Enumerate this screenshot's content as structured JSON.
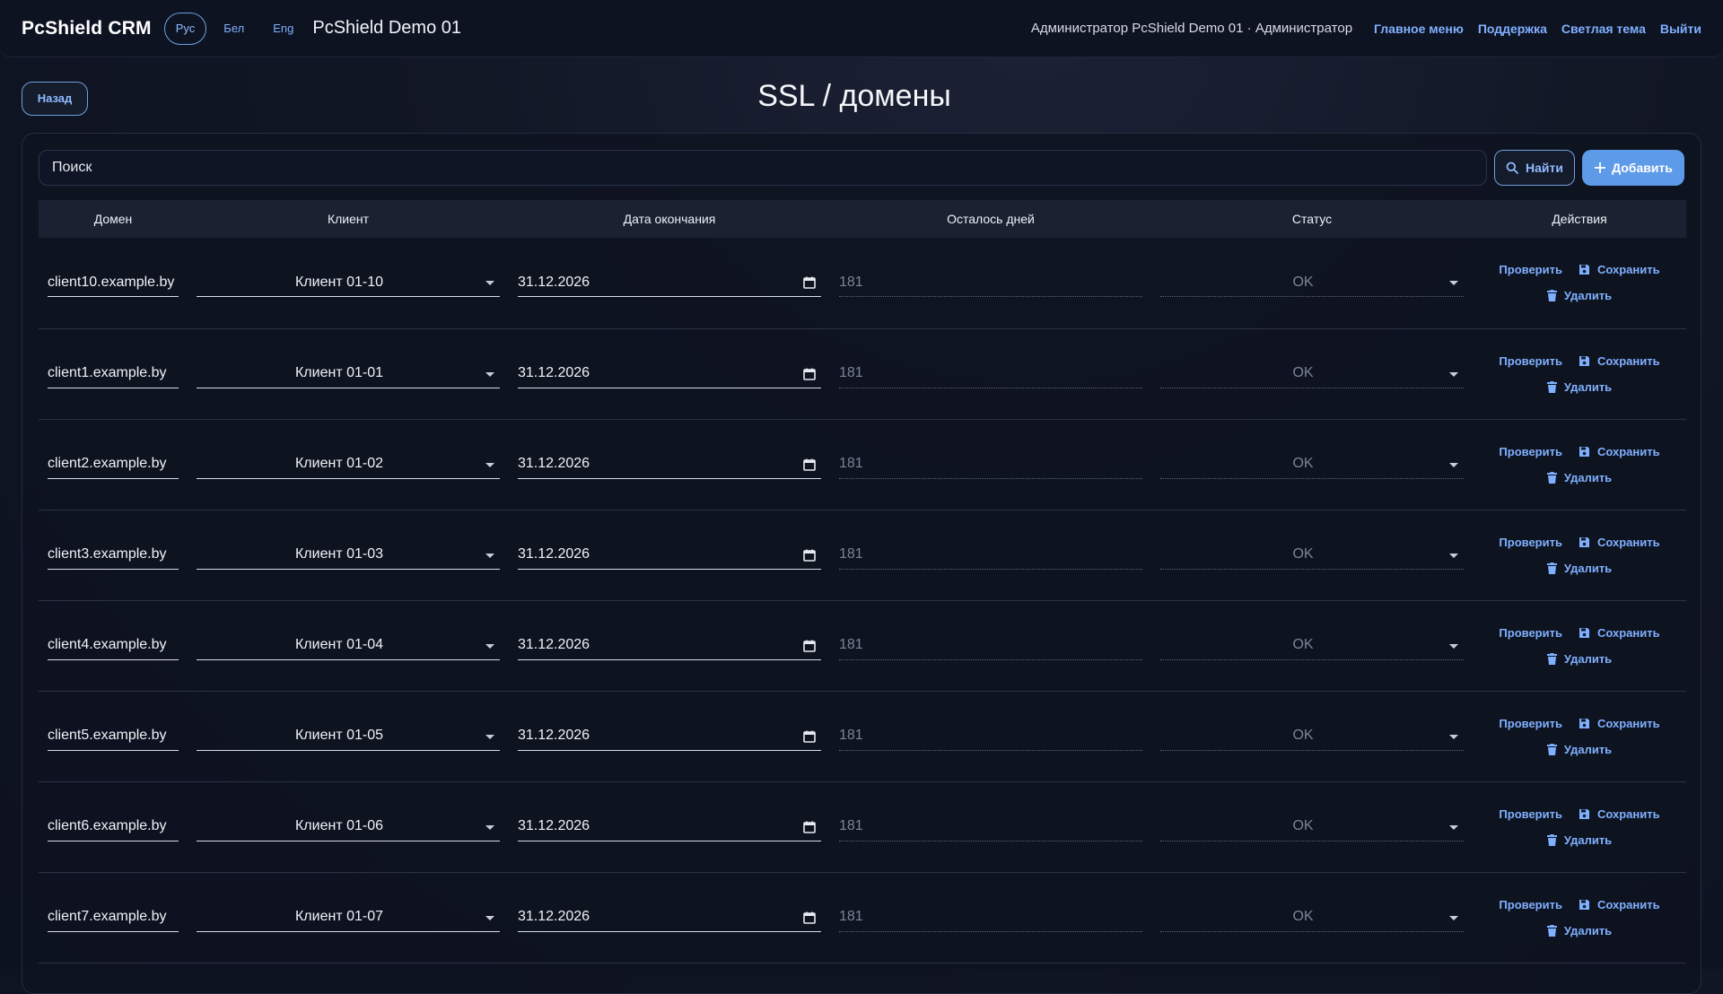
{
  "header": {
    "brand": "PcShield CRM",
    "languages": [
      "Рус",
      "Бел",
      "Eng"
    ],
    "active_language": "Рус",
    "tenant": "PcShield Demo 01",
    "user": "Администратор PcShield Demo 01 · Администратор",
    "links": [
      "Главное меню",
      "Поддержка",
      "Светлая тема",
      "Выйти"
    ]
  },
  "page": {
    "back_label": "Назад",
    "title": "SSL / домены"
  },
  "search": {
    "placeholder": "Поиск",
    "find_label": "Найти",
    "add_label": "Добавить"
  },
  "table": {
    "columns": [
      "Домен",
      "Клиент",
      "Дата окончания",
      "Осталось дней",
      "Статус",
      "Действия"
    ],
    "rows": [
      {
        "domain": "client10.example.by",
        "client": "Клиент 01-10",
        "expires": "31.12.2026",
        "days_left": "181",
        "status": "OK"
      },
      {
        "domain": "client1.example.by",
        "client": "Клиент 01-01",
        "expires": "31.12.2026",
        "days_left": "181",
        "status": "OK"
      },
      {
        "domain": "client2.example.by",
        "client": "Клиент 01-02",
        "expires": "31.12.2026",
        "days_left": "181",
        "status": "OK"
      },
      {
        "domain": "client3.example.by",
        "client": "Клиент 01-03",
        "expires": "31.12.2026",
        "days_left": "181",
        "status": "OK"
      },
      {
        "domain": "client4.example.by",
        "client": "Клиент 01-04",
        "expires": "31.12.2026",
        "days_left": "181",
        "status": "OK"
      },
      {
        "domain": "client5.example.by",
        "client": "Клиент 01-05",
        "expires": "31.12.2026",
        "days_left": "181",
        "status": "OK"
      },
      {
        "domain": "client6.example.by",
        "client": "Клиент 01-06",
        "expires": "31.12.2026",
        "days_left": "181",
        "status": "OK"
      },
      {
        "domain": "client7.example.by",
        "client": "Клиент 01-07",
        "expires": "31.12.2026",
        "days_left": "181",
        "status": "OK"
      }
    ],
    "actions": {
      "check": "Проверить",
      "save": "Сохранить",
      "delete": "Удалить"
    }
  },
  "colors": {
    "accent": "#7fb0ff",
    "primary_button": "#5d9be8",
    "background": "#111624"
  },
  "icons": [
    "search-icon",
    "plus-icon",
    "calendar-icon",
    "save-icon",
    "trash-icon",
    "chevron-down-icon"
  ]
}
